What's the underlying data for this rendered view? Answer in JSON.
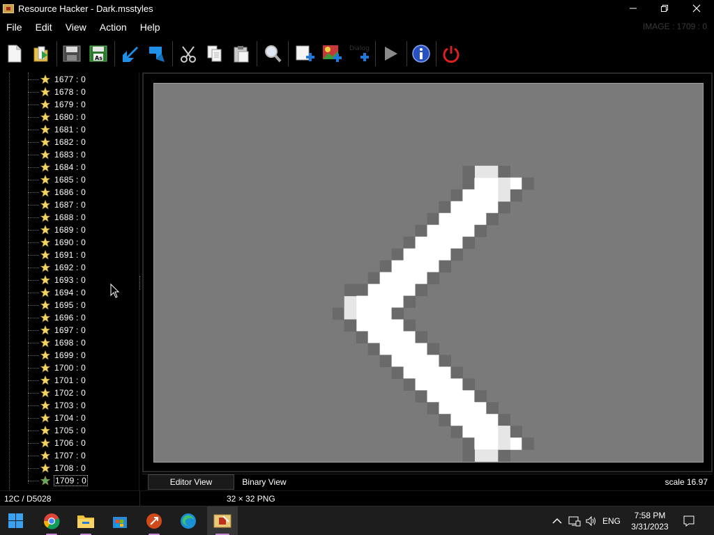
{
  "window": {
    "title": "Resource Hacker - Dark.msstyles",
    "minimize_glyph": "—",
    "maximize_glyph": "❐",
    "close_glyph": "✕"
  },
  "menu": {
    "items": [
      {
        "label": "File"
      },
      {
        "label": "Edit"
      },
      {
        "label": "View"
      },
      {
        "label": "Action"
      },
      {
        "label": "Help"
      }
    ],
    "image_info": "IMAGE : 1709 : 0"
  },
  "toolbar": {
    "dialog_merger_label": "Dialog Merger",
    "icons": [
      "new-file-icon",
      "open-folder-icon",
      "save-icon",
      "save-as-icon",
      "compile-arrow-icon",
      "bookmark-arrow-icon",
      "cut-icon",
      "copy-icon",
      "paste-icon",
      "find-icon",
      "add-blank-resource-icon",
      "add-image-resource-icon",
      "dialog-merger-icon",
      "run-script-icon",
      "info-icon",
      "power-icon"
    ]
  },
  "tree": {
    "items": [
      {
        "label": "1677 : 0"
      },
      {
        "label": "1678 : 0"
      },
      {
        "label": "1679 : 0"
      },
      {
        "label": "1680 : 0"
      },
      {
        "label": "1681 : 0"
      },
      {
        "label": "1682 : 0"
      },
      {
        "label": "1683 : 0"
      },
      {
        "label": "1684 : 0"
      },
      {
        "label": "1685 : 0"
      },
      {
        "label": "1686 : 0"
      },
      {
        "label": "1687 : 0"
      },
      {
        "label": "1688 : 0"
      },
      {
        "label": "1689 : 0"
      },
      {
        "label": "1690 : 0"
      },
      {
        "label": "1691 : 0"
      },
      {
        "label": "1692 : 0"
      },
      {
        "label": "1693 : 0"
      },
      {
        "label": "1694 : 0"
      },
      {
        "label": "1695 : 0"
      },
      {
        "label": "1696 : 0"
      },
      {
        "label": "1697 : 0"
      },
      {
        "label": "1698 : 0"
      },
      {
        "label": "1699 : 0"
      },
      {
        "label": "1700 : 0"
      },
      {
        "label": "1701 : 0"
      },
      {
        "label": "1702 : 0"
      },
      {
        "label": "1703 : 0"
      },
      {
        "label": "1704 : 0"
      },
      {
        "label": "1705 : 0"
      },
      {
        "label": "1706 : 0"
      },
      {
        "label": "1707 : 0"
      },
      {
        "label": "1708 : 0"
      },
      {
        "label": "1709 : 0",
        "selected": true
      }
    ]
  },
  "editor": {
    "tabs": [
      {
        "label": "Editor View",
        "active": true
      },
      {
        "label": "Binary View",
        "active": false
      }
    ],
    "scale": "scale 16.97",
    "image_subject": "chevron-left-icon"
  },
  "status": {
    "offset": "12C / D5028",
    "image_format": "32 × 32  PNG"
  },
  "taskbar": {
    "apps": [
      "windows-start-icon",
      "chrome-icon",
      "file-explorer-icon",
      "store-icon",
      "remote-desktop-icon",
      "edge-icon",
      "resource-hacker-icon"
    ],
    "tray": {
      "lang": "ENG",
      "time": "7:58 PM",
      "date": "3/31/2023"
    }
  },
  "colors": {
    "background": "#000000",
    "canvas": "#7a7a7a",
    "star": "#f2d46a",
    "selected_star": "#5fa86a",
    "taskbar": "#1d1d1d",
    "power_red": "#e02020",
    "info_blue": "#2850c0"
  }
}
